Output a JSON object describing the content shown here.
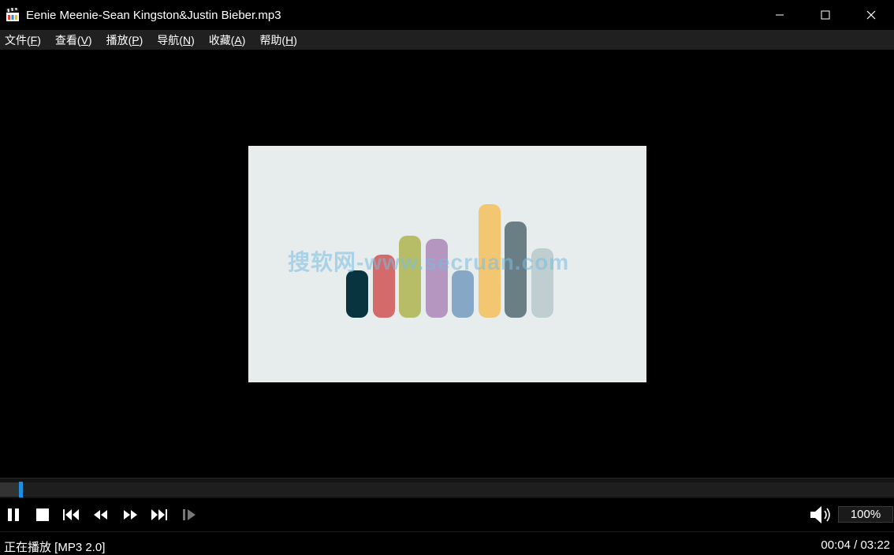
{
  "window": {
    "title": "Eenie Meenie-Sean Kingston&Justin Bieber.mp3",
    "icon": "clapperboard-icon"
  },
  "menu": [
    {
      "label": "文件(",
      "key": "F",
      "suffix": ")"
    },
    {
      "label": "查看(",
      "key": "V",
      "suffix": ")"
    },
    {
      "label": "播放(",
      "key": "P",
      "suffix": ")"
    },
    {
      "label": "导航(",
      "key": "N",
      "suffix": ")"
    },
    {
      "label": "收藏(",
      "key": "A",
      "suffix": ")"
    },
    {
      "label": "帮助(",
      "key": "H",
      "suffix": ")"
    }
  ],
  "artwork": {
    "watermark": "搜软网-www.secruan.com",
    "bars": [
      {
        "color": "#08343f",
        "level": 0.3
      },
      {
        "color": "#d46b6a",
        "level": 0.4
      },
      {
        "color": "#b7bd66",
        "level": 0.52
      },
      {
        "color": "#b496c1",
        "level": 0.5
      },
      {
        "color": "#86a8c6",
        "level": 0.3
      },
      {
        "color": "#f3c771",
        "level": 0.72
      },
      {
        "color": "#6a7e86",
        "level": 0.61
      },
      {
        "color": "#bfcfd1",
        "level": 0.44
      }
    ]
  },
  "playback": {
    "progress": 0.021,
    "accent": "#1d8fe0",
    "zoom": "100%"
  },
  "controls": {
    "icons": [
      "pause-icon",
      "stop-icon",
      "skip-previous-icon",
      "rewind-icon",
      "fast-forward-icon",
      "skip-next-icon",
      "frame-step-icon",
      "volume-icon"
    ]
  },
  "status": {
    "state": "正在播放 [MP3 2.0]",
    "time": "00:04 / 03:22"
  }
}
